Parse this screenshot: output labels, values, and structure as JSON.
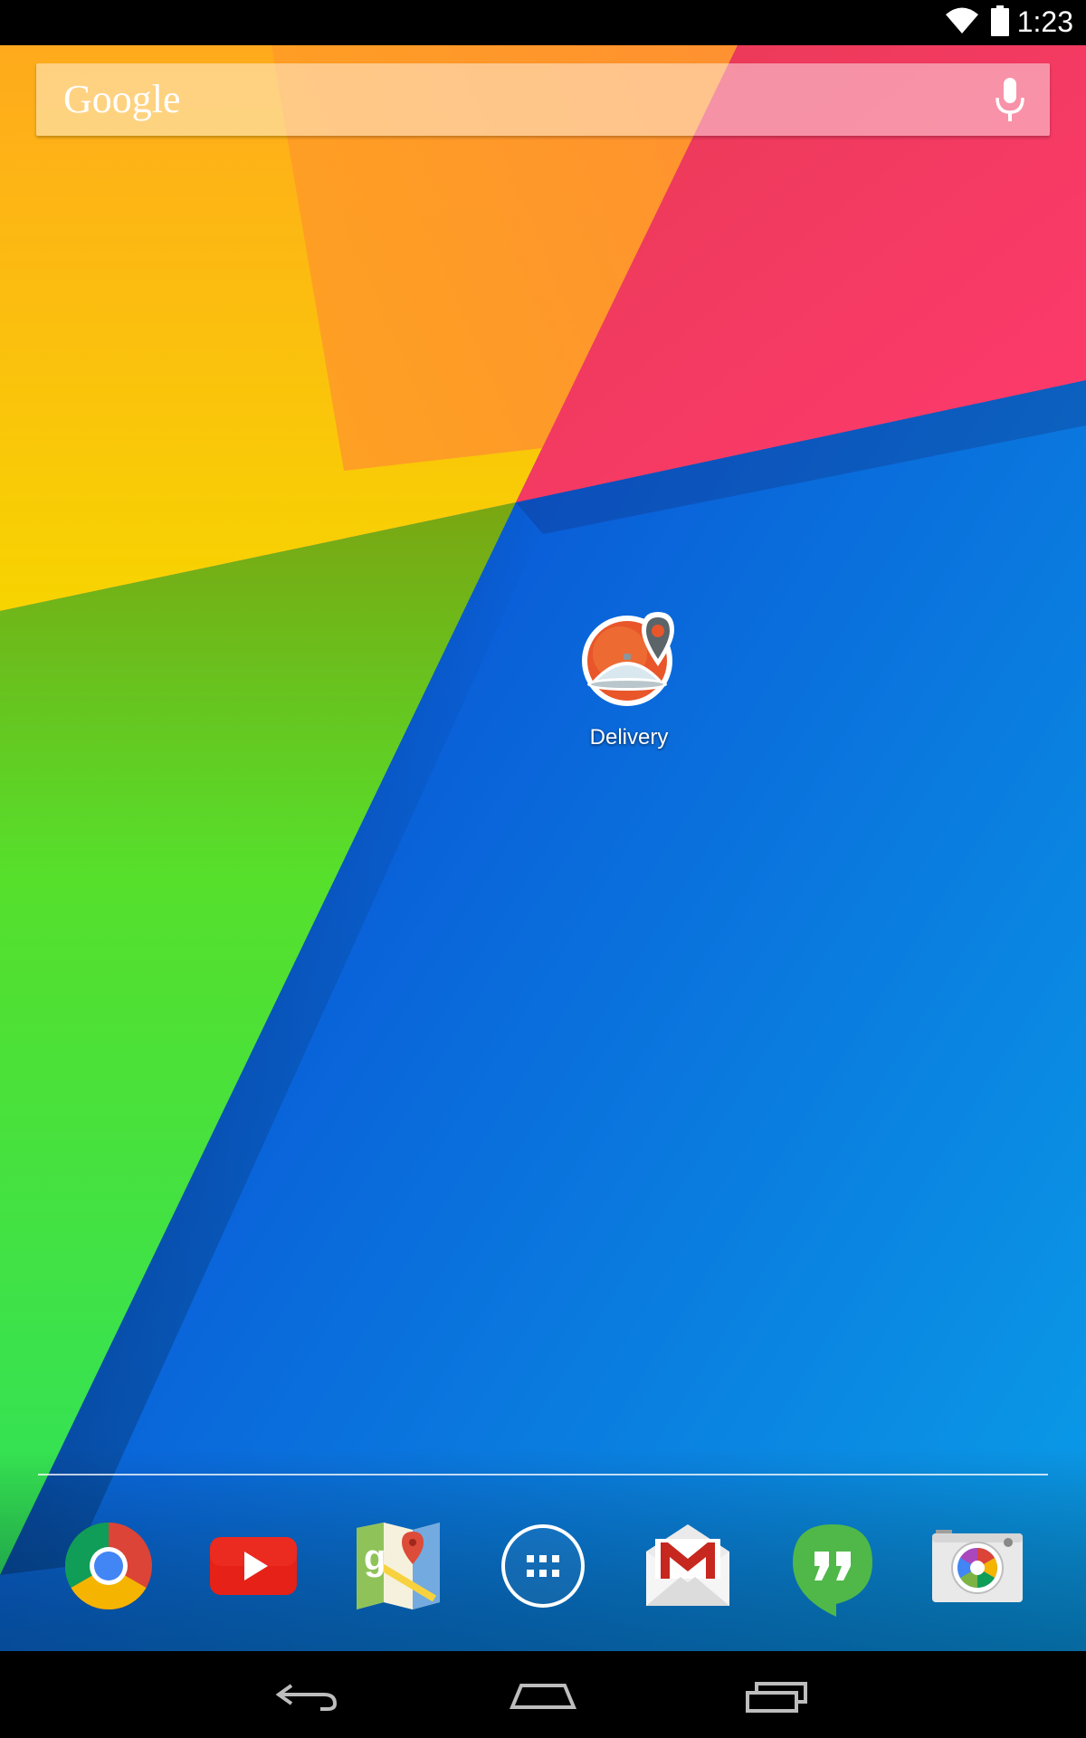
{
  "status_bar": {
    "time": "1:23",
    "wifi_icon": "wifi-icon",
    "battery_icon": "battery-icon"
  },
  "search": {
    "logo_text": "Google",
    "mic_icon": "mic-icon"
  },
  "home": {
    "shortcuts": [
      {
        "label": "Delivery",
        "icon": "delivery-app-icon"
      }
    ]
  },
  "dock": {
    "items": [
      {
        "name": "chrome",
        "icon": "chrome-icon"
      },
      {
        "name": "youtube",
        "icon": "youtube-icon"
      },
      {
        "name": "maps",
        "icon": "maps-icon"
      },
      {
        "name": "app-drawer",
        "icon": "app-drawer-icon"
      },
      {
        "name": "gmail",
        "icon": "gmail-icon"
      },
      {
        "name": "hangouts",
        "icon": "hangouts-icon"
      },
      {
        "name": "camera",
        "icon": "camera-icon"
      }
    ]
  },
  "nav_bar": {
    "back_icon": "back-icon",
    "home_icon": "home-icon",
    "recents_icon": "recents-icon"
  },
  "colors": {
    "status_bar_bg": "#000000",
    "wallpaper_yellow": "#F9C515",
    "wallpaper_orange": "#FF8C2E",
    "wallpaper_pink": "#FF2E62",
    "wallpaper_green": "#3FE23A",
    "wallpaper_blue": "#0A6CE0",
    "delivery_orange": "#E8562A"
  }
}
